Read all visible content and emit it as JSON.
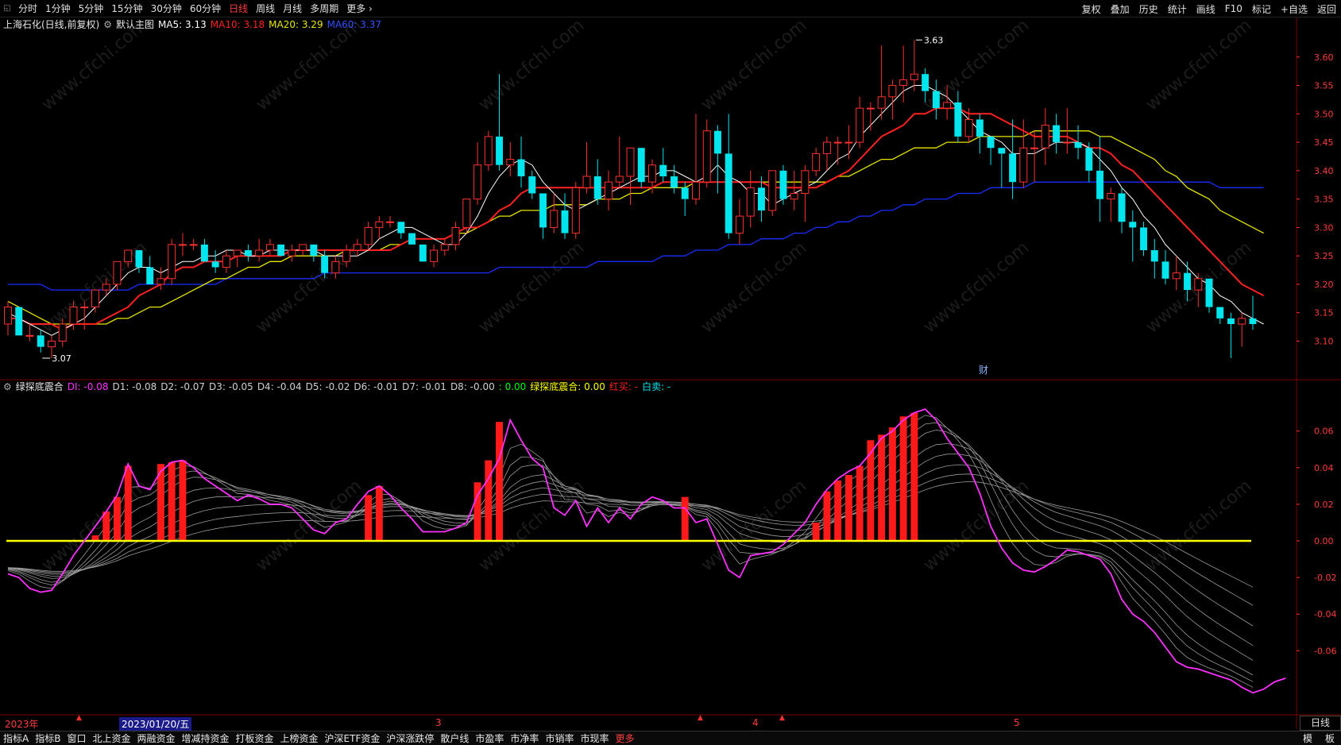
{
  "toolbar": {
    "periods": [
      "分时",
      "1分钟",
      "5分钟",
      "15分钟",
      "30分钟",
      "60分钟",
      "日线",
      "周线",
      "月线",
      "多周期",
      "更多 ›"
    ],
    "active_period": "日线",
    "right_buttons": [
      "复权",
      "叠加",
      "历史",
      "统计",
      "画线",
      "F10",
      "标记",
      "+自选",
      "返回"
    ]
  },
  "main_legend": {
    "title": "上海石化(日线,前复权)",
    "template": "默认主图",
    "ma5": "MA5: 3.13",
    "ma10": "MA10: 3.18",
    "ma20": "MA20: 3.29",
    "ma60": "MA60: 3.37"
  },
  "indicator_legend": {
    "name": "绿探底震合",
    "di": "DI: -0.08",
    "d1": "D1: -0.08",
    "d2": "D2: -0.07",
    "d3": "D3: -0.05",
    "d4": "D4: -0.04",
    "d5": "D5: -0.02",
    "d6": "D6: -0.01",
    "d7": "D7: -0.01",
    "d8": "D8: -0.00",
    "zero": ": 0.00",
    "combo": "绿探底震合: 0.00",
    "red_buy": "红买: -",
    "white_sell": "白卖: -"
  },
  "price_axis": [
    "3.60",
    "3.55",
    "3.50",
    "3.45",
    "3.40",
    "3.35",
    "3.30",
    "3.25",
    "3.20",
    "3.15",
    "3.10"
  ],
  "indicator_axis": [
    "0.06",
    "0.04",
    "0.02",
    "0.00",
    "-0.02",
    "-0.04",
    "-0.06"
  ],
  "annotations": {
    "high": "3.63",
    "low": "3.07",
    "finance_marker": "财"
  },
  "time_axis": {
    "year": "2023年",
    "cursor_date": "2023/01/20/五",
    "months": [
      "3",
      "4",
      "5"
    ]
  },
  "period_box": "日线",
  "bottom_tabs": [
    "指标A",
    "指标B",
    "窗口",
    "北上资金",
    "两融资金",
    "增减持资金",
    "打板资金",
    "上榜资金",
    "沪深ETF资金",
    "沪深涨跌停",
    "散户线",
    "市盈率",
    "市净率",
    "市销率",
    "市现率",
    "更多"
  ],
  "bottom_right": [
    "模",
    "板"
  ],
  "watermark": "www.cfchi.com",
  "colors": {
    "up": "#ff3030",
    "down": "#00e5ee",
    "ma5": "#ffffff",
    "ma10": "#ff2020",
    "ma20": "#e6e600",
    "ma60": "#1a2cff",
    "di_line": "#ff30ff",
    "zero_line": "#ffff00",
    "grid": "#5a0000"
  },
  "chart_data": {
    "type": "candlestick",
    "candles": [
      [
        3.13,
        3.17,
        3.11,
        3.16
      ],
      [
        3.16,
        3.16,
        3.12,
        3.11
      ],
      [
        3.11,
        3.13,
        3.1,
        3.11
      ],
      [
        3.11,
        3.12,
        3.08,
        3.09
      ],
      [
        3.09,
        3.11,
        3.07,
        3.1
      ],
      [
        3.1,
        3.14,
        3.09,
        3.13
      ],
      [
        3.13,
        3.17,
        3.12,
        3.16
      ],
      [
        3.16,
        3.17,
        3.12,
        3.16
      ],
      [
        3.16,
        3.19,
        3.15,
        3.19
      ],
      [
        3.19,
        3.21,
        3.18,
        3.2
      ],
      [
        3.2,
        3.24,
        3.19,
        3.24
      ],
      [
        3.24,
        3.26,
        3.23,
        3.26
      ],
      [
        3.26,
        3.26,
        3.22,
        3.23
      ],
      [
        3.23,
        3.25,
        3.2,
        3.2
      ],
      [
        3.2,
        3.23,
        3.19,
        3.21
      ],
      [
        3.21,
        3.28,
        3.2,
        3.27
      ],
      [
        3.27,
        3.29,
        3.25,
        3.27
      ],
      [
        3.27,
        3.28,
        3.26,
        3.27
      ],
      [
        3.27,
        3.28,
        3.24,
        3.24
      ],
      [
        3.24,
        3.26,
        3.22,
        3.23
      ],
      [
        3.23,
        3.26,
        3.22,
        3.25
      ],
      [
        3.25,
        3.26,
        3.23,
        3.26
      ],
      [
        3.26,
        3.27,
        3.24,
        3.25
      ],
      [
        3.25,
        3.28,
        3.24,
        3.26
      ],
      [
        3.26,
        3.28,
        3.25,
        3.27
      ],
      [
        3.27,
        3.27,
        3.25,
        3.25
      ],
      [
        3.25,
        3.27,
        3.24,
        3.26
      ],
      [
        3.26,
        3.27,
        3.25,
        3.27
      ],
      [
        3.27,
        3.27,
        3.24,
        3.25
      ],
      [
        3.25,
        3.26,
        3.21,
        3.22
      ],
      [
        3.22,
        3.25,
        3.21,
        3.24
      ],
      [
        3.24,
        3.27,
        3.23,
        3.26
      ],
      [
        3.26,
        3.28,
        3.25,
        3.27
      ],
      [
        3.27,
        3.31,
        3.26,
        3.3
      ],
      [
        3.3,
        3.32,
        3.28,
        3.31
      ],
      [
        3.31,
        3.32,
        3.3,
        3.31
      ],
      [
        3.31,
        3.31,
        3.28,
        3.29
      ],
      [
        3.29,
        3.29,
        3.27,
        3.27
      ],
      [
        3.27,
        3.27,
        3.24,
        3.24
      ],
      [
        3.24,
        3.27,
        3.23,
        3.26
      ],
      [
        3.26,
        3.28,
        3.25,
        3.27
      ],
      [
        3.27,
        3.31,
        3.26,
        3.3
      ],
      [
        3.3,
        3.35,
        3.29,
        3.35
      ],
      [
        3.35,
        3.45,
        3.34,
        3.41
      ],
      [
        3.41,
        3.47,
        3.4,
        3.46
      ],
      [
        3.46,
        3.57,
        3.4,
        3.41
      ],
      [
        3.41,
        3.45,
        3.39,
        3.42
      ],
      [
        3.42,
        3.46,
        3.37,
        3.39
      ],
      [
        3.39,
        3.4,
        3.35,
        3.36
      ],
      [
        3.36,
        3.36,
        3.28,
        3.3
      ],
      [
        3.3,
        3.36,
        3.29,
        3.33
      ],
      [
        3.33,
        3.36,
        3.28,
        3.29
      ],
      [
        3.29,
        3.38,
        3.28,
        3.37
      ],
      [
        3.37,
        3.45,
        3.36,
        3.39
      ],
      [
        3.39,
        3.42,
        3.34,
        3.35
      ],
      [
        3.35,
        3.4,
        3.33,
        3.38
      ],
      [
        3.38,
        3.46,
        3.37,
        3.39
      ],
      [
        3.39,
        3.44,
        3.34,
        3.44
      ],
      [
        3.44,
        3.44,
        3.37,
        3.38
      ],
      [
        3.38,
        3.42,
        3.36,
        3.41
      ],
      [
        3.41,
        3.44,
        3.38,
        3.39
      ],
      [
        3.39,
        3.41,
        3.36,
        3.37
      ],
      [
        3.37,
        3.38,
        3.32,
        3.35
      ],
      [
        3.35,
        3.5,
        3.34,
        3.38
      ],
      [
        3.38,
        3.49,
        3.37,
        3.47
      ],
      [
        3.47,
        3.48,
        3.36,
        3.43
      ],
      [
        3.43,
        3.5,
        3.28,
        3.29
      ],
      [
        3.29,
        3.35,
        3.27,
        3.32
      ],
      [
        3.32,
        3.4,
        3.3,
        3.37
      ],
      [
        3.37,
        3.39,
        3.31,
        3.33
      ],
      [
        3.33,
        3.4,
        3.32,
        3.4
      ],
      [
        3.4,
        3.41,
        3.34,
        3.35
      ],
      [
        3.35,
        3.4,
        3.33,
        3.36
      ],
      [
        3.36,
        3.41,
        3.31,
        3.4
      ],
      [
        3.4,
        3.44,
        3.39,
        3.43
      ],
      [
        3.43,
        3.46,
        3.4,
        3.45
      ],
      [
        3.45,
        3.46,
        3.41,
        3.45
      ],
      [
        3.45,
        3.48,
        3.42,
        3.45
      ],
      [
        3.45,
        3.53,
        3.44,
        3.51
      ],
      [
        3.51,
        3.52,
        3.47,
        3.51
      ],
      [
        3.51,
        3.62,
        3.49,
        3.53
      ],
      [
        3.53,
        3.56,
        3.49,
        3.55
      ],
      [
        3.55,
        3.62,
        3.52,
        3.56
      ],
      [
        3.56,
        3.63,
        3.54,
        3.57
      ],
      [
        3.57,
        3.58,
        3.52,
        3.54
      ],
      [
        3.54,
        3.56,
        3.49,
        3.51
      ],
      [
        3.51,
        3.55,
        3.49,
        3.52
      ],
      [
        3.52,
        3.54,
        3.45,
        3.46
      ],
      [
        3.46,
        3.51,
        3.45,
        3.49
      ],
      [
        3.49,
        3.5,
        3.43,
        3.46
      ],
      [
        3.46,
        3.46,
        3.41,
        3.44
      ],
      [
        3.44,
        3.44,
        3.37,
        3.43
      ],
      [
        3.43,
        3.49,
        3.35,
        3.38
      ],
      [
        3.38,
        3.49,
        3.37,
        3.44
      ],
      [
        3.44,
        3.47,
        3.38,
        3.44
      ],
      [
        3.44,
        3.51,
        3.41,
        3.48
      ],
      [
        3.48,
        3.5,
        3.43,
        3.45
      ],
      [
        3.45,
        3.51,
        3.43,
        3.45
      ],
      [
        3.45,
        3.48,
        3.42,
        3.44
      ],
      [
        3.44,
        3.45,
        3.38,
        3.4
      ],
      [
        3.4,
        3.46,
        3.31,
        3.35
      ],
      [
        3.35,
        3.37,
        3.31,
        3.36
      ],
      [
        3.36,
        3.37,
        3.29,
        3.31
      ],
      [
        3.31,
        3.33,
        3.24,
        3.3
      ],
      [
        3.3,
        3.31,
        3.25,
        3.26
      ],
      [
        3.26,
        3.28,
        3.21,
        3.24
      ],
      [
        3.24,
        3.26,
        3.2,
        3.21
      ],
      [
        3.21,
        3.25,
        3.19,
        3.22
      ],
      [
        3.22,
        3.24,
        3.17,
        3.19
      ],
      [
        3.19,
        3.22,
        3.16,
        3.21
      ],
      [
        3.21,
        3.21,
        3.15,
        3.16
      ],
      [
        3.16,
        3.16,
        3.13,
        3.14
      ],
      [
        3.14,
        3.15,
        3.07,
        3.13
      ],
      [
        3.13,
        3.15,
        3.09,
        3.14
      ],
      [
        3.14,
        3.18,
        3.12,
        3.13
      ]
    ],
    "ma5": [
      3.15,
      3.14,
      3.13,
      3.12,
      3.11,
      3.12,
      3.13,
      3.14,
      3.16,
      3.18,
      3.2,
      3.22,
      3.23,
      3.23,
      3.22,
      3.23,
      3.24,
      3.24,
      3.25,
      3.25,
      3.26,
      3.26,
      3.25,
      3.25,
      3.26,
      3.26,
      3.26,
      3.26,
      3.26,
      3.25,
      3.25,
      3.25,
      3.25,
      3.26,
      3.28,
      3.29,
      3.3,
      3.3,
      3.29,
      3.28,
      3.27,
      3.27,
      3.29,
      3.32,
      3.36,
      3.39,
      3.41,
      3.42,
      3.41,
      3.38,
      3.36,
      3.34,
      3.33,
      3.34,
      3.35,
      3.36,
      3.37,
      3.38,
      3.39,
      3.39,
      3.4,
      3.4,
      3.39,
      3.38,
      3.39,
      3.41,
      3.39,
      3.38,
      3.36,
      3.36,
      3.34,
      3.35,
      3.36,
      3.37,
      3.38,
      3.4,
      3.42,
      3.43,
      3.46,
      3.48,
      3.5,
      3.52,
      3.54,
      3.55,
      3.55,
      3.54,
      3.53,
      3.51,
      3.49,
      3.47,
      3.46,
      3.45,
      3.43,
      3.43,
      3.43,
      3.44,
      3.45,
      3.45,
      3.45,
      3.44,
      3.42,
      3.4,
      3.37,
      3.35,
      3.32,
      3.3,
      3.27,
      3.25,
      3.23,
      3.21,
      3.2,
      3.18,
      3.17,
      3.15,
      3.14,
      3.13
    ],
    "ma10": [
      3.14,
      3.14,
      3.13,
      3.13,
      3.13,
      3.12,
      3.13,
      3.13,
      3.13,
      3.14,
      3.15,
      3.16,
      3.18,
      3.19,
      3.2,
      3.22,
      3.23,
      3.23,
      3.24,
      3.24,
      3.24,
      3.25,
      3.25,
      3.25,
      3.25,
      3.25,
      3.26,
      3.26,
      3.26,
      3.26,
      3.26,
      3.26,
      3.26,
      3.26,
      3.26,
      3.26,
      3.27,
      3.28,
      3.28,
      3.28,
      3.28,
      3.29,
      3.3,
      3.3,
      3.31,
      3.33,
      3.34,
      3.36,
      3.37,
      3.37,
      3.37,
      3.37,
      3.37,
      3.37,
      3.37,
      3.37,
      3.37,
      3.37,
      3.37,
      3.37,
      3.38,
      3.38,
      3.38,
      3.38,
      3.38,
      3.38,
      3.38,
      3.38,
      3.38,
      3.38,
      3.37,
      3.37,
      3.37,
      3.37,
      3.37,
      3.38,
      3.39,
      3.4,
      3.42,
      3.44,
      3.46,
      3.47,
      3.48,
      3.5,
      3.5,
      3.51,
      3.51,
      3.51,
      3.5,
      3.5,
      3.5,
      3.49,
      3.48,
      3.47,
      3.46,
      3.46,
      3.46,
      3.46,
      3.45,
      3.44,
      3.44,
      3.43,
      3.41,
      3.4,
      3.38,
      3.36,
      3.34,
      3.32,
      3.3,
      3.28,
      3.26,
      3.24,
      3.22,
      3.2,
      3.19,
      3.18
    ],
    "ma20": [
      3.17,
      3.16,
      3.15,
      3.14,
      3.13,
      3.13,
      3.13,
      3.13,
      3.13,
      3.13,
      3.14,
      3.14,
      3.15,
      3.16,
      3.16,
      3.17,
      3.18,
      3.19,
      3.2,
      3.21,
      3.21,
      3.22,
      3.23,
      3.23,
      3.24,
      3.24,
      3.25,
      3.25,
      3.25,
      3.25,
      3.25,
      3.26,
      3.26,
      3.26,
      3.26,
      3.27,
      3.27,
      3.28,
      3.28,
      3.28,
      3.28,
      3.29,
      3.29,
      3.3,
      3.31,
      3.32,
      3.32,
      3.33,
      3.33,
      3.33,
      3.34,
      3.34,
      3.34,
      3.34,
      3.35,
      3.35,
      3.35,
      3.36,
      3.36,
      3.37,
      3.37,
      3.37,
      3.37,
      3.38,
      3.38,
      3.38,
      3.38,
      3.38,
      3.38,
      3.38,
      3.38,
      3.38,
      3.38,
      3.38,
      3.38,
      3.38,
      3.39,
      3.39,
      3.4,
      3.41,
      3.42,
      3.42,
      3.43,
      3.44,
      3.44,
      3.44,
      3.45,
      3.45,
      3.45,
      3.46,
      3.46,
      3.46,
      3.46,
      3.46,
      3.47,
      3.47,
      3.47,
      3.47,
      3.47,
      3.47,
      3.46,
      3.46,
      3.45,
      3.44,
      3.43,
      3.42,
      3.4,
      3.39,
      3.37,
      3.36,
      3.35,
      3.33,
      3.32,
      3.31,
      3.3,
      3.29
    ],
    "ma60": [
      3.2,
      3.2,
      3.2,
      3.2,
      3.19,
      3.19,
      3.19,
      3.19,
      3.19,
      3.19,
      3.19,
      3.19,
      3.2,
      3.2,
      3.2,
      3.2,
      3.2,
      3.2,
      3.2,
      3.2,
      3.21,
      3.21,
      3.21,
      3.21,
      3.21,
      3.21,
      3.21,
      3.21,
      3.21,
      3.22,
      3.22,
      3.22,
      3.22,
      3.22,
      3.22,
      3.22,
      3.22,
      3.22,
      3.22,
      3.22,
      3.22,
      3.22,
      3.22,
      3.22,
      3.22,
      3.23,
      3.23,
      3.23,
      3.23,
      3.23,
      3.23,
      3.23,
      3.23,
      3.23,
      3.24,
      3.24,
      3.24,
      3.24,
      3.24,
      3.24,
      3.25,
      3.25,
      3.25,
      3.26,
      3.26,
      3.26,
      3.27,
      3.27,
      3.27,
      3.28,
      3.28,
      3.28,
      3.29,
      3.29,
      3.3,
      3.3,
      3.31,
      3.31,
      3.32,
      3.32,
      3.33,
      3.33,
      3.34,
      3.34,
      3.35,
      3.35,
      3.35,
      3.36,
      3.36,
      3.36,
      3.37,
      3.37,
      3.37,
      3.37,
      3.38,
      3.38,
      3.38,
      3.38,
      3.38,
      3.38,
      3.38,
      3.38,
      3.38,
      3.38,
      3.38,
      3.38,
      3.38,
      3.38,
      3.38,
      3.38,
      3.38,
      3.37,
      3.37,
      3.37,
      3.37,
      3.37
    ],
    "di": [
      -0.018,
      -0.02,
      -0.026,
      -0.028,
      -0.027,
      -0.018,
      -0.008,
      0.0,
      0.008,
      0.016,
      0.025,
      0.042,
      0.03,
      0.028,
      0.038,
      0.043,
      0.044,
      0.04,
      0.034,
      0.03,
      0.026,
      0.022,
      0.025,
      0.023,
      0.02,
      0.02,
      0.018,
      0.012,
      0.006,
      0.004,
      0.01,
      0.012,
      0.02,
      0.027,
      0.03,
      0.025,
      0.018,
      0.012,
      0.005,
      0.005,
      0.005,
      0.007,
      0.01,
      0.025,
      0.034,
      0.045,
      0.066,
      0.055,
      0.045,
      0.04,
      0.018,
      0.014,
      0.022,
      0.008,
      0.018,
      0.01,
      0.018,
      0.012,
      0.02,
      0.024,
      0.022,
      0.018,
      0.018,
      0.01,
      0.012,
      -0.002,
      -0.016,
      -0.02,
      -0.008,
      -0.007,
      -0.006,
      -0.002,
      0.004,
      0.01,
      0.02,
      0.028,
      0.034,
      0.038,
      0.041,
      0.048,
      0.056,
      0.06,
      0.066,
      0.07,
      0.072,
      0.066,
      0.056,
      0.048,
      0.04,
      0.026,
      0.008,
      -0.004,
      -0.012,
      -0.016,
      -0.017,
      -0.014,
      -0.01,
      -0.005,
      -0.006,
      -0.008,
      -0.01,
      -0.018,
      -0.032,
      -0.04,
      -0.044,
      -0.05,
      -0.058,
      -0.066,
      -0.069,
      -0.07,
      -0.072,
      -0.074,
      -0.076,
      -0.08,
      -0.083,
      -0.081,
      -0.077,
      -0.075
    ],
    "bars": [
      0,
      0,
      0,
      0,
      0,
      0,
      0,
      0,
      0.003,
      0.016,
      0.024,
      0.041,
      0,
      0,
      0.042,
      0.043,
      0.044,
      0,
      0,
      0,
      0,
      0,
      0,
      0,
      0,
      0,
      0,
      0,
      0,
      0,
      0,
      0,
      0,
      0.025,
      0.03,
      0,
      0,
      0,
      0,
      0,
      0,
      0,
      0,
      0.032,
      0.044,
      0.065,
      0,
      0,
      0,
      0,
      0,
      0,
      0,
      0,
      0,
      0,
      0,
      0,
      0,
      0,
      0,
      0,
      0.024,
      0,
      0,
      0,
      0,
      0,
      0,
      0,
      0,
      0,
      0,
      0,
      0.01,
      0.027,
      0.033,
      0.036,
      0.041,
      0.055,
      0.058,
      0.062,
      0.068,
      0.07,
      0,
      0,
      0,
      0,
      0,
      0,
      0,
      0,
      0,
      0,
      0,
      0,
      0,
      0,
      0,
      0,
      0,
      0,
      0,
      0,
      0,
      0,
      0,
      0,
      0,
      0,
      0,
      0,
      0,
      0,
      0,
      0,
      0
    ]
  }
}
